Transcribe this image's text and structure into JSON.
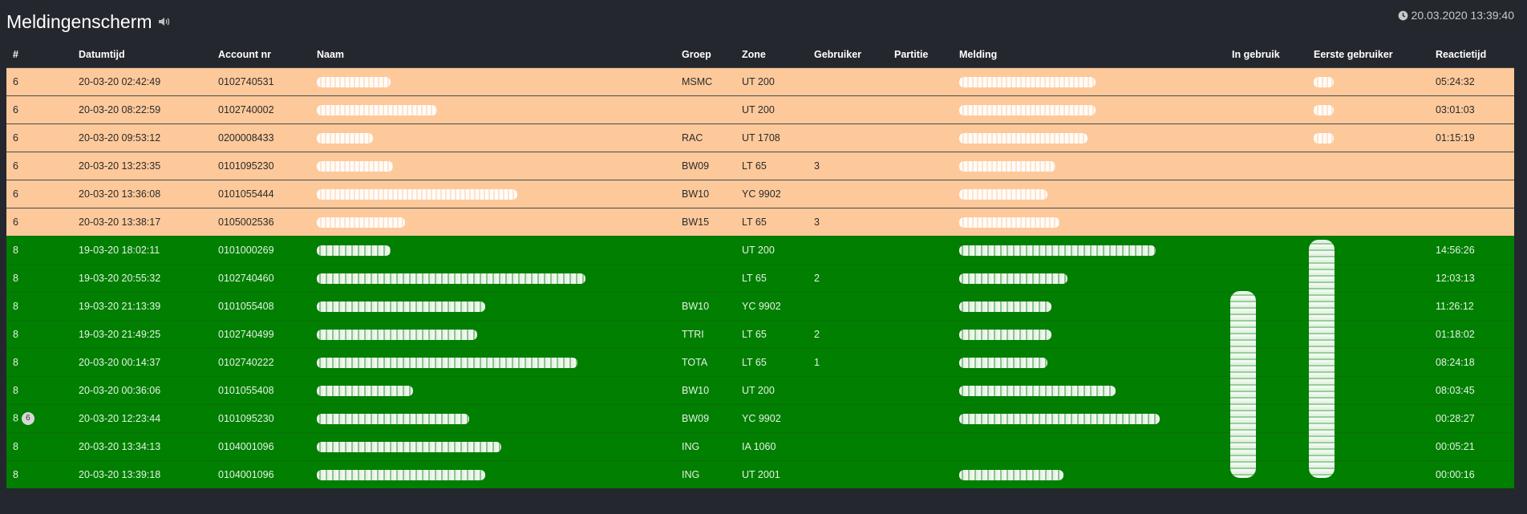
{
  "header": {
    "title": "Meldingenscherm",
    "clock": "20.03.2020 13:39:40"
  },
  "columns": [
    "#",
    "Datumtijd",
    "Account nr",
    "Naam",
    "Groep",
    "Zone",
    "Gebruiker",
    "Partitie",
    "Melding",
    "In gebruik",
    "Eerste gebruiker",
    "Reactietijd"
  ],
  "rows": [
    {
      "nr": "6",
      "datum": "20-03-20 02:42:49",
      "account": "0102740531",
      "groep": "MSMC",
      "zone": "UT 200",
      "gebruiker": "",
      "reactie": "05:24:32",
      "status": "orange"
    },
    {
      "nr": "6",
      "datum": "20-03-20 08:22:59",
      "account": "0102740002",
      "groep": "",
      "zone": "UT 200",
      "gebruiker": "",
      "reactie": "03:01:03",
      "status": "orange"
    },
    {
      "nr": "6",
      "datum": "20-03-20 09:53:12",
      "account": "0200008433",
      "groep": "RAC",
      "zone": "UT 1708",
      "gebruiker": "",
      "reactie": "01:15:19",
      "status": "orange"
    },
    {
      "nr": "6",
      "datum": "20-03-20 13:23:35",
      "account": "0101095230",
      "groep": "BW09",
      "zone": "LT 65",
      "gebruiker": "3",
      "reactie": "",
      "status": "orange"
    },
    {
      "nr": "6",
      "datum": "20-03-20 13:36:08",
      "account": "0101055444",
      "groep": "BW10",
      "zone": "YC 9902",
      "gebruiker": "",
      "reactie": "",
      "status": "orange"
    },
    {
      "nr": "6",
      "datum": "20-03-20 13:38:17",
      "account": "0105002536",
      "groep": "BW15",
      "zone": "LT 65",
      "gebruiker": "3",
      "reactie": "",
      "status": "orange"
    },
    {
      "nr": "8",
      "datum": "19-03-20 18:02:11",
      "account": "0101000269",
      "groep": "",
      "zone": "UT 200",
      "gebruiker": "",
      "reactie": "14:56:26",
      "status": "green"
    },
    {
      "nr": "8",
      "datum": "19-03-20 20:55:32",
      "account": "0102740460",
      "groep": "",
      "zone": "LT 65",
      "gebruiker": "2",
      "reactie": "12:03:13",
      "status": "green"
    },
    {
      "nr": "8",
      "datum": "19-03-20 21:13:39",
      "account": "0101055408",
      "groep": "BW10",
      "zone": "YC 9902",
      "gebruiker": "",
      "reactie": "11:26:12",
      "status": "green"
    },
    {
      "nr": "8",
      "datum": "19-03-20 21:49:25",
      "account": "0102740499",
      "groep": "TTRI",
      "zone": "LT 65",
      "gebruiker": "2",
      "reactie": "01:18:02",
      "status": "green"
    },
    {
      "nr": "8",
      "datum": "20-03-20 00:14:37",
      "account": "0102740222",
      "groep": "TOTA",
      "zone": "LT 65",
      "gebruiker": "1",
      "reactie": "08:24:18",
      "status": "green"
    },
    {
      "nr": "8",
      "datum": "20-03-20 00:36:06",
      "account": "0101055408",
      "groep": "BW10",
      "zone": "UT 200",
      "gebruiker": "",
      "reactie": "08:03:45",
      "status": "green"
    },
    {
      "nr": "8",
      "datum": "20-03-20 12:23:44",
      "account": "0101095230",
      "groep": "BW09",
      "zone": "YC 9902",
      "gebruiker": "",
      "reactie": "00:28:27",
      "status": "green",
      "badge": "6"
    },
    {
      "nr": "8",
      "datum": "20-03-20 13:34:13",
      "account": "0104001096",
      "groep": "ING",
      "zone": "IA 1060",
      "gebruiker": "",
      "reactie": "00:05:21",
      "status": "green"
    },
    {
      "nr": "8",
      "datum": "20-03-20 13:39:18",
      "account": "0104001096",
      "groep": "ING",
      "zone": "UT 2001",
      "gebruiker": "",
      "reactie": "00:00:16",
      "status": "green"
    }
  ]
}
